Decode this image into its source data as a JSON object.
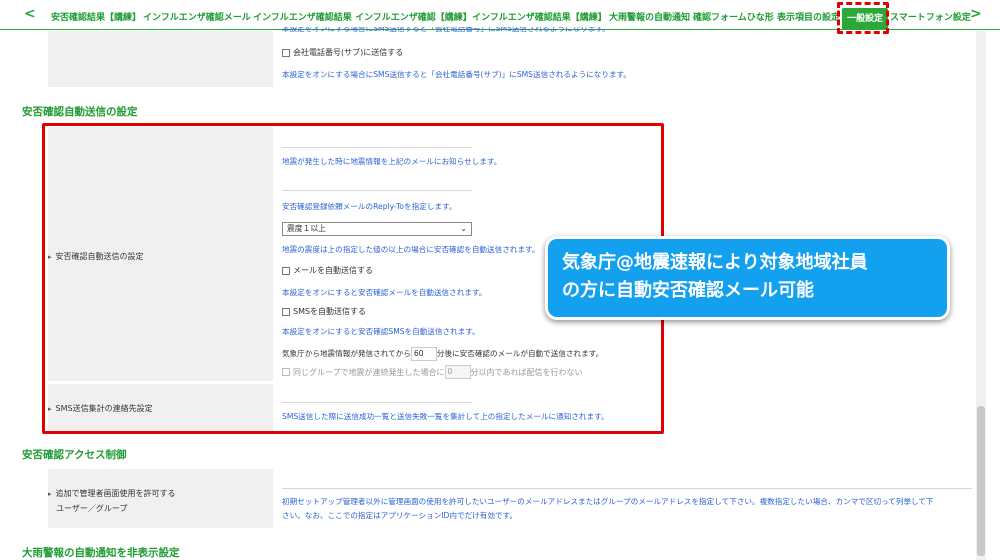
{
  "tabs": {
    "prev_arrow": "<",
    "next_arrow": ">",
    "items": [
      {
        "label": "安否確認結果【講練】"
      },
      {
        "label": "インフルエンザ確認メール"
      },
      {
        "label": "インフルエンザ確認結果"
      },
      {
        "label": "インフルエンザ確認【講練】"
      },
      {
        "label": "インフルエンザ確認結果【講練】"
      },
      {
        "label": "大雨警報の自動通知"
      },
      {
        "label": "確認フォームひな形"
      },
      {
        "label": "表示項目の設定"
      },
      {
        "label": "一般設定"
      },
      {
        "label": "スマートフォン設定"
      }
    ],
    "active_index": 8
  },
  "top_block": {
    "cut_text": "本設定をオンにする場合にSMS送信すると「会社電話番号」にSMS送信されるようになります。",
    "checkbox_label": "会社電話番号(サブ)に送信する",
    "note": "本設定をオンにする場合にSMS送信すると「会社電話番号(サブ)」にSMS送信されるようになります。"
  },
  "auto_send": {
    "heading": "安否確認自動送信の設定",
    "label": "安否確認自動送信の設定",
    "note1": "地震が発生した時に地震情報を上記のメールにお知らせします。",
    "note2": "安否確認登録依頼メールのReply-Toを指定します。",
    "select_value": "震度１以上",
    "note3": "地震の震度は上の指定した値の以上の場合に安否確認を自動送信されます。",
    "mail_checkbox": "メールを自動送信する",
    "note4": "本設定をオンにすると安否確認メールを自動送信されます。",
    "sms_checkbox": "SMSを自動送信する",
    "note5": "本設定をオンにすると安否確認SMSを自動送信されます。",
    "delay_prefix": "気象庁から地震情報が発信されてから",
    "delay_value": "60",
    "delay_suffix": "分後に安否確認のメールが自動で送信されます。",
    "same_group_prefix": "同じグループで地震が連続発生した場合に",
    "same_group_value": "0",
    "same_group_suffix": "分以内であれば配信を行わない"
  },
  "sms_report": {
    "label": "SMS送信集計の連絡先設定",
    "note": "SMS送信した際に送信成功一覧と送信失敗一覧を集計して上の指定したメールに通知されます。"
  },
  "access": {
    "heading": "安否確認アクセス制御",
    "label_line1": "追加で管理者画面使用を許可する",
    "label_line2": "ユーザー／グループ",
    "note_line1": "初期セットアップ管理者以外に管理画面の使用を許可したいユーザーのメールアドレスまたはグループのメールアドレスを指定して下さい。複数指定したい場合、カンマで区切って列挙して下",
    "note_line2": "さい。なお、ここでの指定はアプリケーションID内でだけ有効です。"
  },
  "bottom_heading": "大雨警報の自動通知を非表示設定",
  "callout": {
    "line1": "気象庁@地震速報により対象地域社員",
    "line2": "の方に自動安否確認メール可能"
  },
  "colors": {
    "accent_green": "#2aa83a",
    "link_blue": "#2c62d6",
    "highlight_red": "#e00000",
    "callout_blue": "#12a0ef"
  }
}
